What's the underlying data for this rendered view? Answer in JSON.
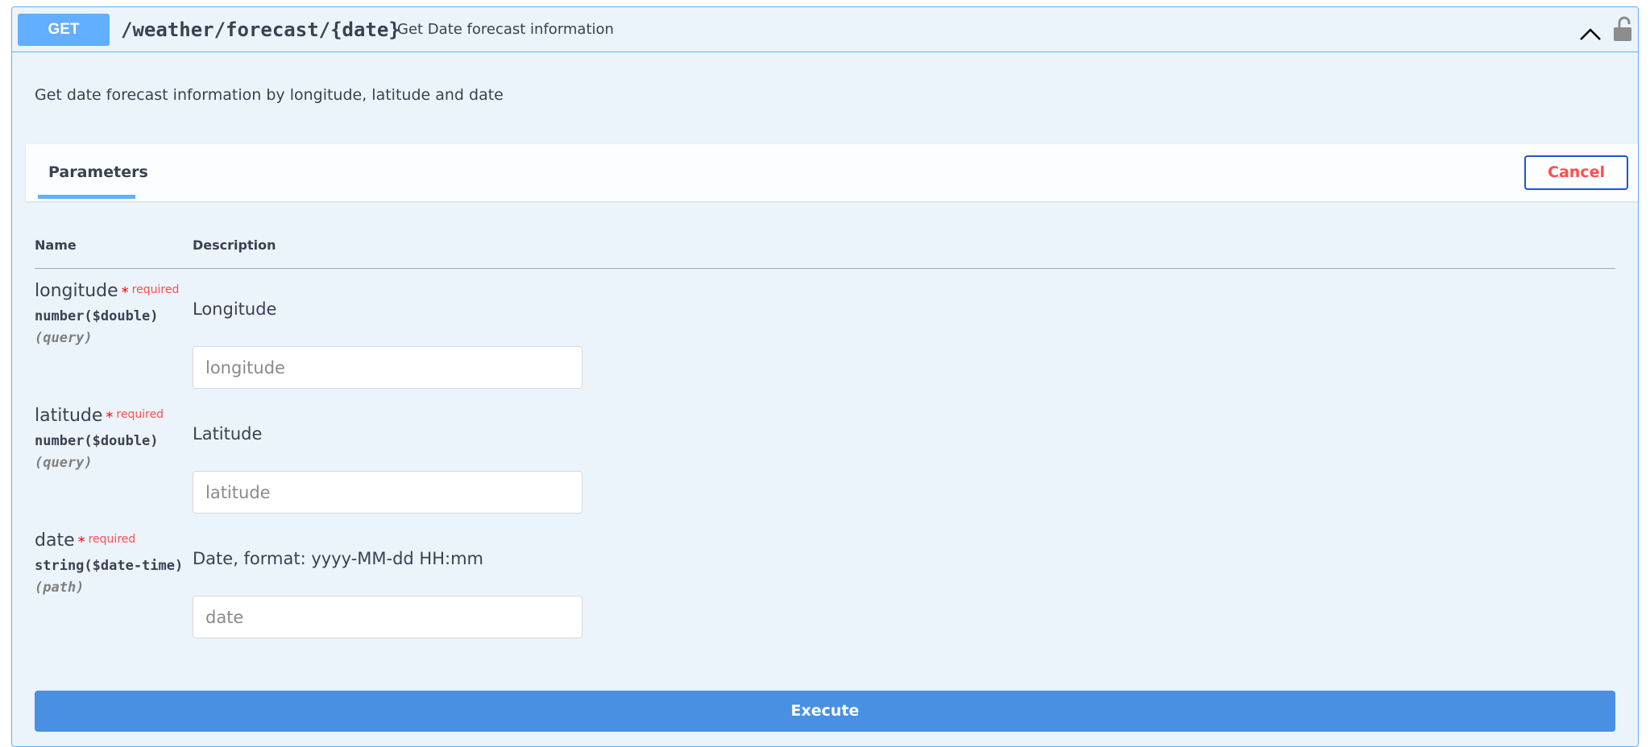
{
  "operation": {
    "method": "GET",
    "path": "/weather/forecast/{date}",
    "summary": "Get Date forecast information",
    "description": "Get date forecast information by longitude, latitude and date"
  },
  "section": {
    "tab_label": "Parameters",
    "cancel_label": "Cancel"
  },
  "table": {
    "col_name": "Name",
    "col_description": "Description"
  },
  "params": [
    {
      "name": "longitude",
      "required_star": "*",
      "required_label": "required",
      "type": "number($double)",
      "in": "(query)",
      "description": "Longitude",
      "placeholder": "longitude",
      "value": ""
    },
    {
      "name": "latitude",
      "required_star": "*",
      "required_label": "required",
      "type": "number($double)",
      "in": "(query)",
      "description": "Latitude",
      "placeholder": "latitude",
      "value": ""
    },
    {
      "name": "date",
      "required_star": "*",
      "required_label": "required",
      "type": "string($date-time)",
      "in": "(path)",
      "description": "Date, format: yyyy-MM-dd HH:mm",
      "placeholder": "date",
      "value": ""
    }
  ],
  "execute_label": "Execute",
  "icons": {
    "collapse": "chevron-up-icon",
    "auth": "lock-icon"
  },
  "colors": {
    "get_accent": "#61affe",
    "block_bg": "#ebf3fb",
    "execute": "#4990e2",
    "cancel_border": "#1b56cf",
    "required": "#ff4d4d"
  }
}
